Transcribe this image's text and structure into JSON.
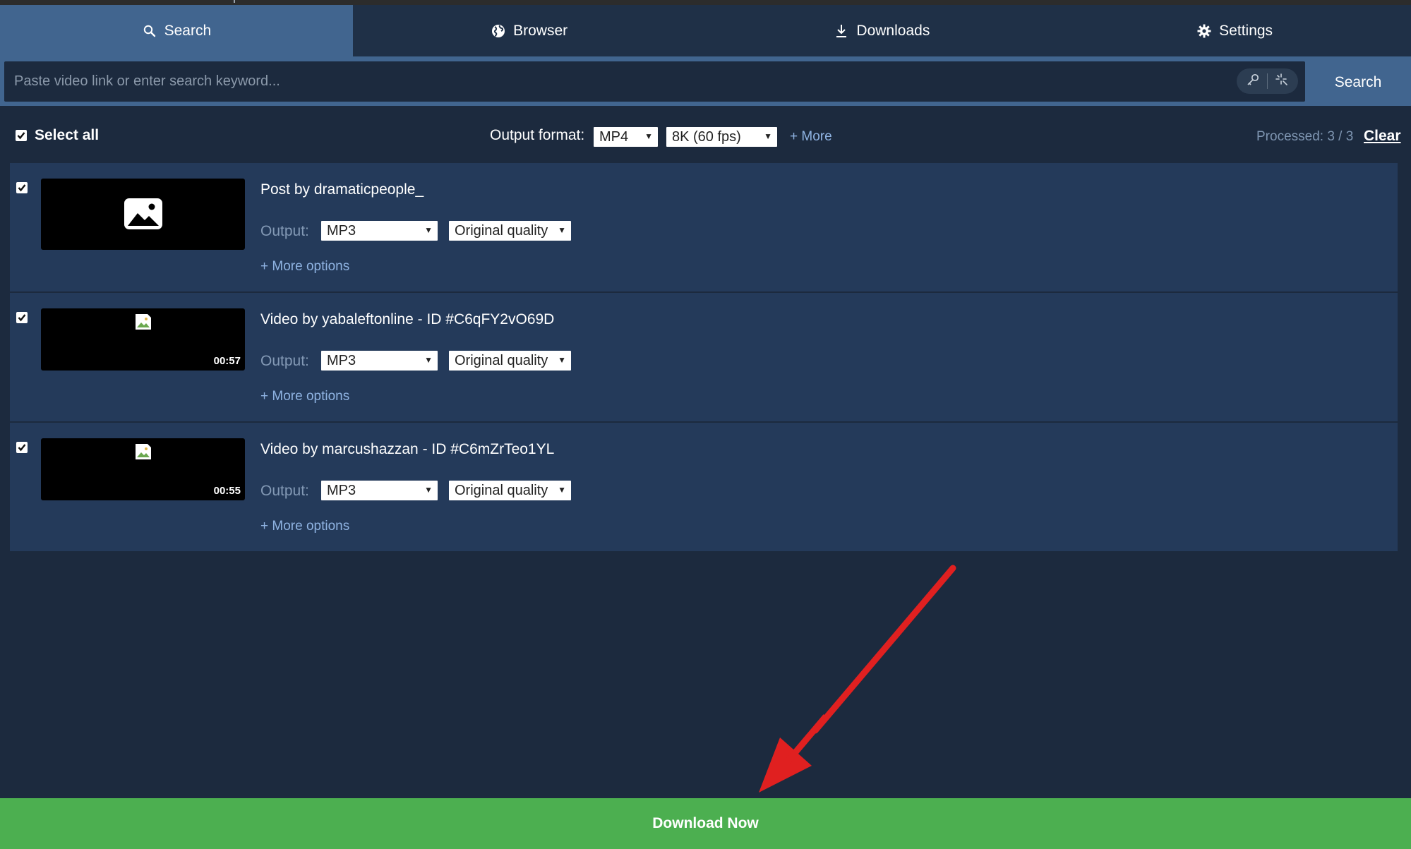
{
  "tabs": [
    {
      "label": "Search",
      "icon": "search-icon",
      "active": true
    },
    {
      "label": "Browser",
      "icon": "globe-icon",
      "active": false
    },
    {
      "label": "Downloads",
      "icon": "download-icon",
      "active": false
    },
    {
      "label": "Settings",
      "icon": "gear-icon",
      "active": false
    }
  ],
  "search": {
    "placeholder": "Paste video link or enter search keyword...",
    "value": "",
    "button_label": "Search",
    "tools": [
      "key-icon",
      "sparkle-icon"
    ]
  },
  "toolbar": {
    "select_all_label": "Select all",
    "select_all_checked": true,
    "output_format_label": "Output format:",
    "format_value": "MP4",
    "quality_value": "8K (60 fps)",
    "more_label": "+ More",
    "processed_text": "Processed: 3 / 3",
    "clear_label": "Clear"
  },
  "items": [
    {
      "title": "Post by dramaticpeople_",
      "output_label": "Output:",
      "format": "MP3",
      "quality": "Original quality",
      "more_options": "+ More options",
      "duration": "",
      "checked": true,
      "thumb": "image-placeholder-icon"
    },
    {
      "title": "Video by yabaleftonline - ID #C6qFY2vO69D",
      "output_label": "Output:",
      "format": "MP3",
      "quality": "Original quality",
      "more_options": "+ More options",
      "duration": "00:57",
      "checked": true,
      "thumb": "broken-image-icon"
    },
    {
      "title": "Video by marcushazzan - ID #C6mZrTeo1YL",
      "output_label": "Output:",
      "format": "MP3",
      "quality": "Original quality",
      "more_options": "+ More options",
      "duration": "00:55",
      "checked": true,
      "thumb": "broken-image-icon"
    }
  ],
  "download_button_label": "Download Now",
  "colors": {
    "background": "#1c2a3e",
    "accent": "#41658f",
    "item_bg": "#243a5a",
    "download_green": "#4caf50",
    "annotation_arrow": "#e02020"
  }
}
